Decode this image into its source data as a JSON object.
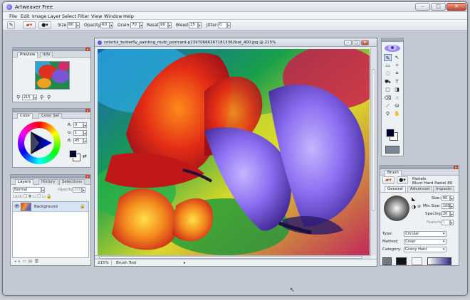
{
  "app": {
    "title": "Artweaver Free"
  },
  "window_buttons": {
    "minimize": "–",
    "maximize": "□",
    "close": "✕"
  },
  "menu": [
    "File",
    "Edit",
    "Image",
    "Layer",
    "Select",
    "Filter",
    "View",
    "Window",
    "Help"
  ],
  "toolbar": {
    "size_label": "Size:",
    "size_value": "80",
    "opacity_label": "Opacity:",
    "opacity_value": "60",
    "grain_label": "Grain:",
    "grain_value": "70",
    "resat_label": "Resat:",
    "resat_value": "90",
    "bleed_label": "Bleed:",
    "bleed_value": "25",
    "jitter_label": "Jitter:",
    "jitter_value": "0"
  },
  "preview_panel": {
    "tabs": [
      "Preview",
      "Info"
    ],
    "zoom_value": "215"
  },
  "color_panel": {
    "tabs": [
      "Color",
      "Color Set"
    ],
    "r_label": "R:",
    "r_value": "0",
    "g_label": "G:",
    "g_value": "1",
    "b_label": "B:",
    "b_value": "45"
  },
  "layers_panel": {
    "tabs": [
      "Layers",
      "History",
      "Selections"
    ],
    "blend_mode": "Normal",
    "opacity_label": "Opacity:",
    "opacity_value": "100",
    "lock_label": "Lock:",
    "layers": [
      {
        "name": "Background"
      }
    ]
  },
  "document": {
    "title": "colorful_butterfly_painting_multi_postcard-p239706863671813362bat_400.jpg @ 215%",
    "zoom": "215%",
    "status": "Brush Tool"
  },
  "brush_panel": {
    "title": "Brush",
    "category_name": "Pastels",
    "variant_name": "Blunt Hard Pastel 80",
    "tabs": [
      "General",
      "Advanced",
      "Impasto"
    ],
    "size_label": "Size:",
    "size_value": "80",
    "min_size_label": "Min Size:",
    "min_size_value": "100",
    "spacing_label": "Spacing:",
    "spacing_value": "20",
    "feature_label": "Feature:",
    "feature_value": "1",
    "type_label": "Type:",
    "type_value": "Circular",
    "method_label": "Method:",
    "method_value": "Cover",
    "category_label": "Category:",
    "category_value": "Grainy Hard"
  },
  "colors": {
    "accent": "#6b52d6",
    "foreground": "#00012d",
    "background": "#ffffff",
    "close_red": "#c4452f"
  }
}
